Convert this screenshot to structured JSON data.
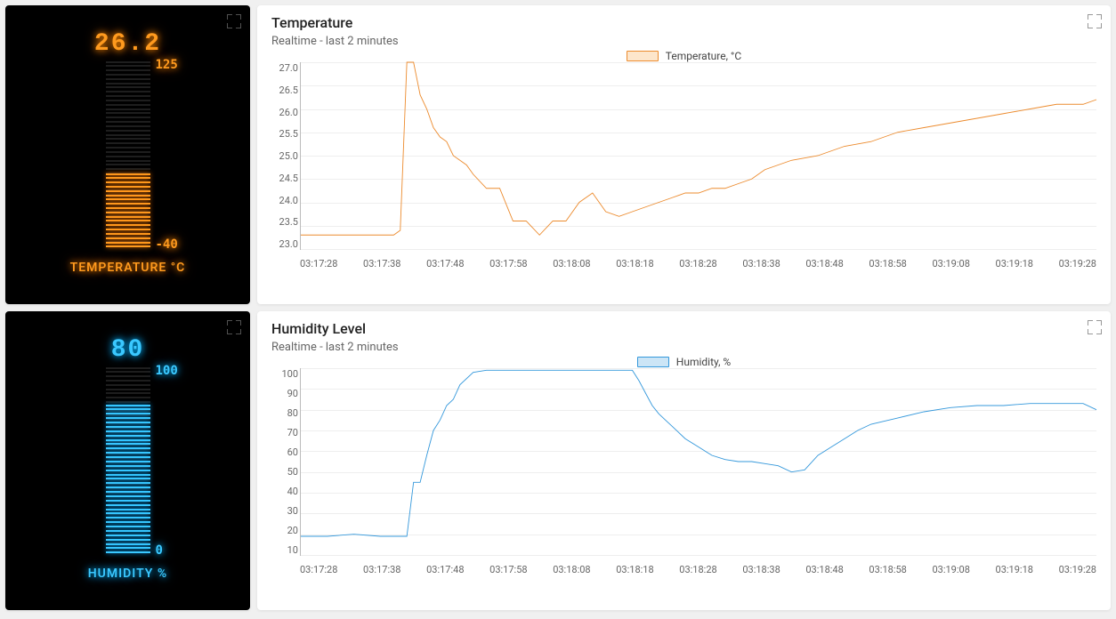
{
  "gauges": {
    "temperature": {
      "value": "26.2",
      "max": "125",
      "min": "-40",
      "label": "TEMPERATURE °C",
      "fill_pct": 40
    },
    "humidity": {
      "value": "80",
      "max": "100",
      "min": "0",
      "label": "HUMIDITY %",
      "fill_pct": 80
    }
  },
  "charts": {
    "temperature": {
      "title": "Temperature",
      "subtitle": "Realtime - last 2 minutes",
      "legend": "Temperature, °C",
      "color": "#ec8b2e",
      "fill": "#fde6cc"
    },
    "humidity": {
      "title": "Humidity Level",
      "subtitle": "Realtime - last 2 minutes",
      "legend": "Humidity, %",
      "color": "#3498db",
      "fill": "#cce5f6"
    }
  },
  "chart_data": [
    {
      "type": "line",
      "title": "Temperature",
      "legend": [
        "Temperature, °C"
      ],
      "xlabel": "",
      "ylabel": "",
      "ylim": [
        23.0,
        27.0
      ],
      "x_ticks": [
        "03:17:28",
        "03:17:38",
        "03:17:48",
        "03:17:58",
        "03:18:08",
        "03:18:18",
        "03:18:28",
        "03:18:38",
        "03:18:48",
        "03:18:58",
        "03:19:08",
        "03:19:18",
        "03:19:28"
      ],
      "y_ticks": [
        23.0,
        23.5,
        24.0,
        24.5,
        25.0,
        25.5,
        26.0,
        26.5,
        27.0
      ],
      "series": [
        {
          "name": "Temperature, °C",
          "x": [
            0,
            2,
            4,
            6,
            8,
            10,
            12,
            14,
            15,
            16,
            17,
            18,
            19,
            20,
            21,
            22,
            23,
            24,
            25,
            26,
            28,
            30,
            32,
            34,
            36,
            38,
            40,
            42,
            44,
            46,
            48,
            50,
            52,
            54,
            56,
            58,
            60,
            62,
            64,
            66,
            68,
            70,
            74,
            78,
            82,
            86,
            90,
            94,
            98,
            102,
            106,
            110,
            114,
            118,
            120
          ],
          "values": [
            23.3,
            23.3,
            23.3,
            23.3,
            23.3,
            23.3,
            23.3,
            23.3,
            23.4,
            27.0,
            27.0,
            26.3,
            26.0,
            25.6,
            25.4,
            25.3,
            25.0,
            24.9,
            24.8,
            24.6,
            24.3,
            24.3,
            23.6,
            23.6,
            23.3,
            23.6,
            23.6,
            24.0,
            24.2,
            23.8,
            23.7,
            23.8,
            23.9,
            24.0,
            24.1,
            24.2,
            24.2,
            24.3,
            24.3,
            24.4,
            24.5,
            24.7,
            24.9,
            25.0,
            25.2,
            25.3,
            25.5,
            25.6,
            25.7,
            25.8,
            25.9,
            26.0,
            26.1,
            26.1,
            26.2
          ]
        }
      ]
    },
    {
      "type": "line",
      "title": "Humidity Level",
      "legend": [
        "Humidity, %"
      ],
      "xlabel": "",
      "ylabel": "",
      "ylim": [
        10,
        100
      ],
      "x_ticks": [
        "03:17:28",
        "03:17:38",
        "03:17:48",
        "03:17:58",
        "03:18:08",
        "03:18:18",
        "03:18:28",
        "03:18:38",
        "03:18:48",
        "03:18:58",
        "03:19:08",
        "03:19:18",
        "03:19:28"
      ],
      "y_ticks": [
        10,
        20,
        30,
        40,
        50,
        60,
        70,
        80,
        90,
        100
      ],
      "series": [
        {
          "name": "Humidity, %",
          "x": [
            0,
            4,
            8,
            12,
            14,
            15,
            16,
            17,
            18,
            19,
            20,
            21,
            22,
            23,
            24,
            26,
            28,
            32,
            36,
            40,
            44,
            48,
            50,
            51,
            52,
            53,
            54,
            55,
            56,
            58,
            60,
            62,
            64,
            66,
            68,
            70,
            72,
            74,
            76,
            78,
            80,
            82,
            84,
            86,
            90,
            94,
            98,
            102,
            106,
            110,
            114,
            118,
            120
          ],
          "values": [
            19,
            19,
            20,
            19,
            19,
            19,
            19,
            45,
            45,
            58,
            70,
            75,
            82,
            85,
            92,
            98,
            99,
            99,
            99,
            99,
            99,
            99,
            99,
            94,
            88,
            82,
            78,
            75,
            72,
            66,
            62,
            58,
            56,
            55,
            55,
            54,
            53,
            50,
            51,
            58,
            62,
            66,
            70,
            73,
            76,
            79,
            81,
            82,
            82,
            83,
            83,
            83,
            80
          ]
        }
      ]
    }
  ]
}
